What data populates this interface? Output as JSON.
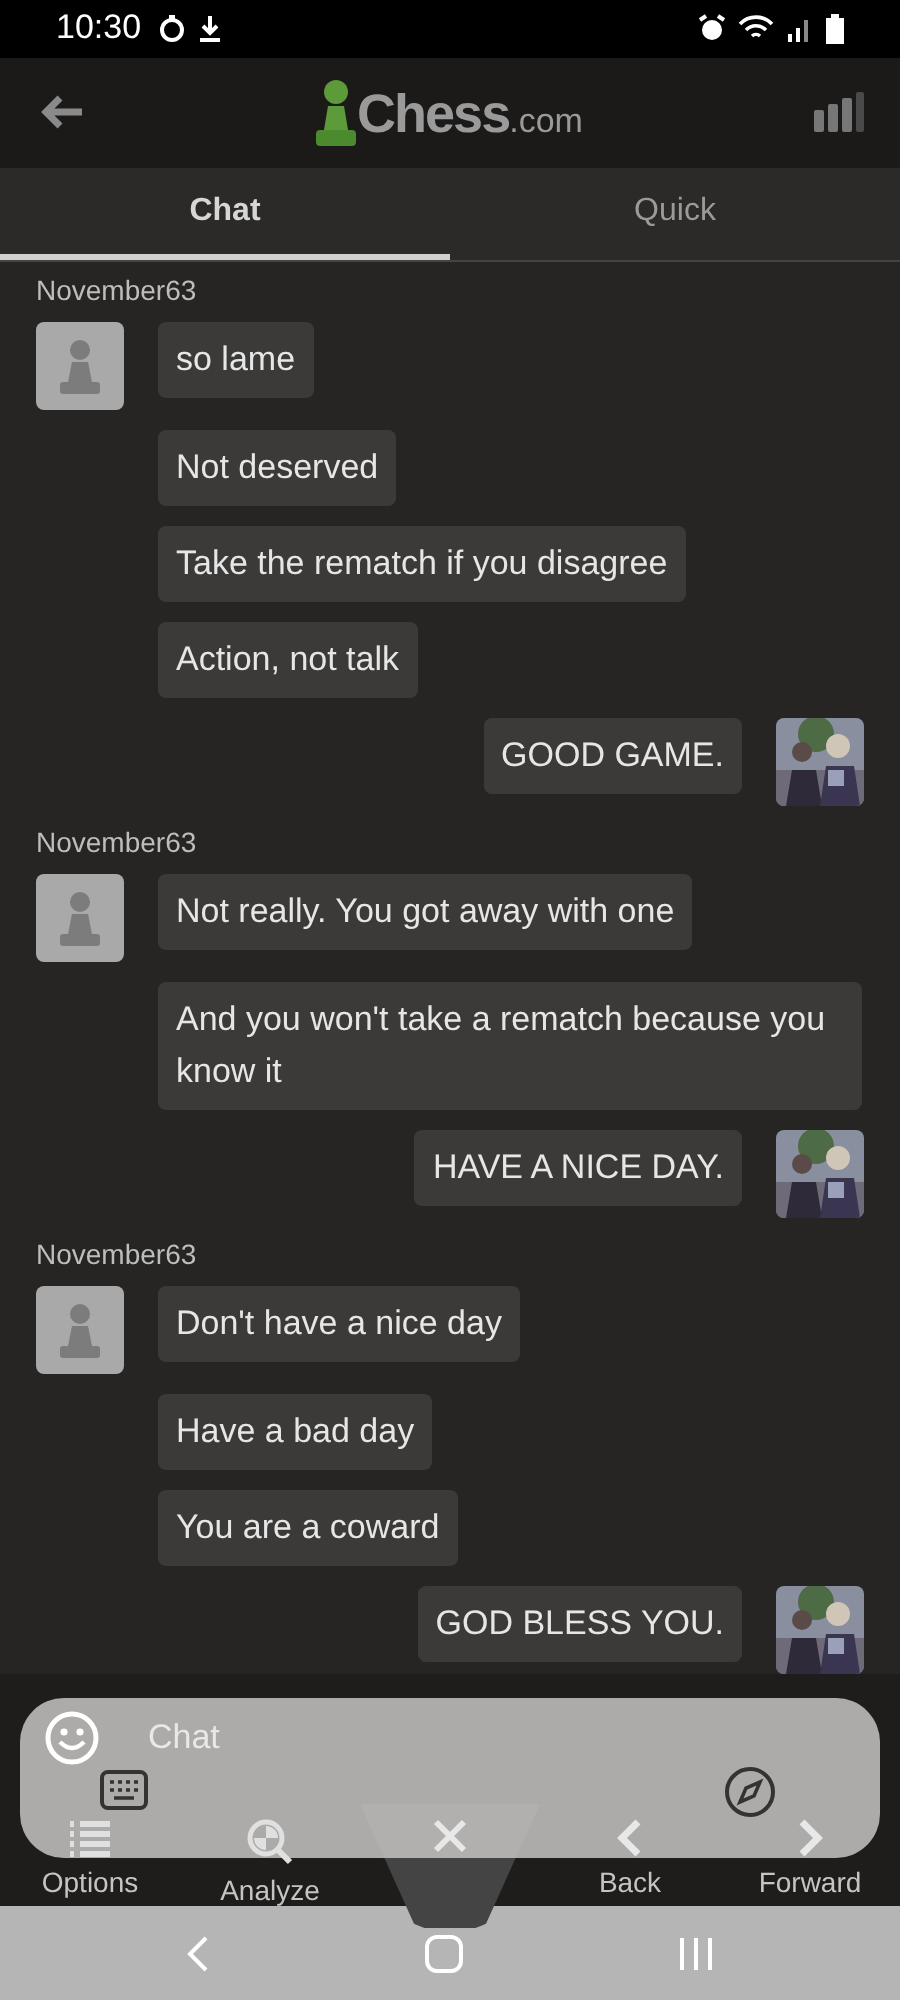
{
  "status_bar": {
    "time": "10:30"
  },
  "header": {
    "logo_text": "Chess",
    "logo_suffix": ".com"
  },
  "tabs": [
    {
      "label": "Chat",
      "selected": true
    },
    {
      "label": "Quick",
      "selected": false
    }
  ],
  "messages": [
    {
      "kind": "sender",
      "text": "November63"
    },
    {
      "kind": "them",
      "text": "so lame",
      "avatar": true
    },
    {
      "kind": "them",
      "text": "Not deserved",
      "avatar": false
    },
    {
      "kind": "them",
      "text": "Take the rematch if you disagree",
      "avatar": false
    },
    {
      "kind": "them",
      "text": "Action, not talk",
      "avatar": false
    },
    {
      "kind": "me",
      "text": "GOOD GAME.",
      "avatar": true
    },
    {
      "kind": "sender",
      "text": "November63"
    },
    {
      "kind": "them",
      "text": "Not really. You got away with one",
      "avatar": true
    },
    {
      "kind": "them",
      "text": "And you won't take a rematch because you know it",
      "avatar": false
    },
    {
      "kind": "me",
      "text": "HAVE A NICE DAY.",
      "avatar": true
    },
    {
      "kind": "sender",
      "text": "November63"
    },
    {
      "kind": "them",
      "text": "Don't have a nice day",
      "avatar": true
    },
    {
      "kind": "them",
      "text": "Have a bad day",
      "avatar": false
    },
    {
      "kind": "them",
      "text": "You are a coward",
      "avatar": false
    },
    {
      "kind": "me",
      "text": "GOD BLESS YOU.",
      "avatar": true
    }
  ],
  "chat_input": {
    "placeholder": "Chat"
  },
  "toolbar": [
    {
      "kind": "options",
      "label": "Options"
    },
    {
      "kind": "analyze",
      "label": "Analyze"
    },
    {
      "kind": "close"
    },
    {
      "kind": "back",
      "label": "Back"
    },
    {
      "kind": "forward",
      "label": "Forward"
    }
  ]
}
